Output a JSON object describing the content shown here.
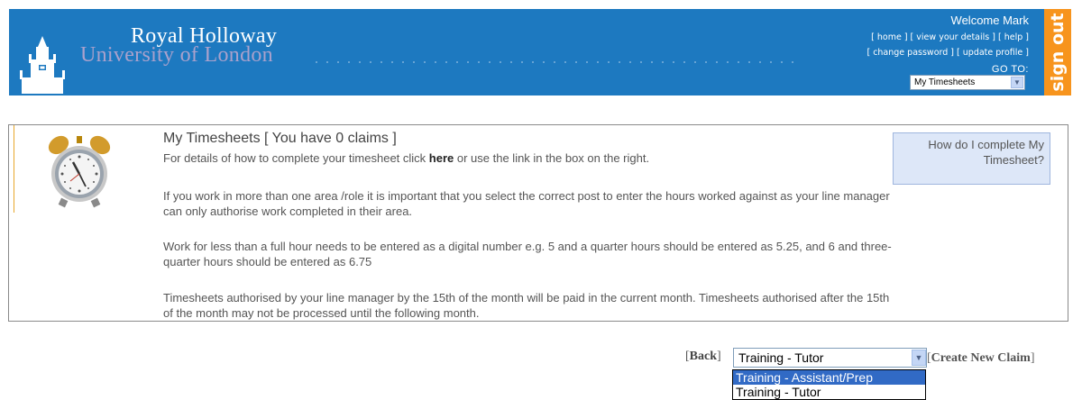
{
  "header": {
    "logo_title": "Royal Holloway",
    "logo_subtitle": "University of London",
    "welcome": "Welcome Mark",
    "links": {
      "home": "home",
      "view_details": "view your details",
      "help": "help",
      "change_password": "change password",
      "update_profile": "update profile"
    },
    "goto_label": "GO TO:",
    "goto_selected": "My Timesheets",
    "sign_out": "sign out",
    "colors": {
      "header_bg": "#1d79c0",
      "signout_bg": "#f7941d"
    }
  },
  "info": {
    "icon": "alarm-clock-icon",
    "title": "My Timesheets [ You have 0 claims ]",
    "p1_before": "For details of how to complete your timesheet click ",
    "p1_link": "here",
    "p1_after": " or use the link in the box on the right.",
    "p2": "If you work in more than one area /role it is important that you select the correct post to enter the hours worked against as your line manager can only authorise work completed in their area.",
    "p3": "Work for less than a full hour needs to be entered as a digital number e.g. 5 and a quarter hours should be entered as 5.25, and 6 and three-quarter hours should be entered as 6.75",
    "p4": "Timesheets authorised by your line manager by the 15th of the month will be paid in the current month. Timesheets authorised after the 15th of the month may not be processed until the following month.",
    "help_box": "How do I complete My Timesheet?"
  },
  "claim": {
    "back": "Back",
    "selected": "Training - Tutor",
    "create": "Create New Claim",
    "options": [
      "Training - Assistant/Prep",
      "Training - Tutor"
    ],
    "highlighted_option": "Training - Assistant/Prep"
  }
}
